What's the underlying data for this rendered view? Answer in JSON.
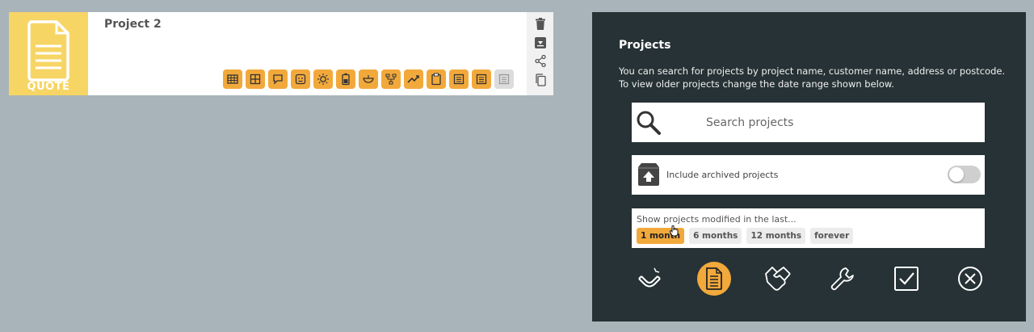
{
  "project_card": {
    "title": "Project 2",
    "type_label": "QUOTE",
    "tools": [
      {
        "icon": "building-grid-icon",
        "enabled": true
      },
      {
        "icon": "window-grid-icon",
        "enabled": true
      },
      {
        "icon": "speech-bubble-icon",
        "enabled": true
      },
      {
        "icon": "face-icon",
        "enabled": true
      },
      {
        "icon": "sun-icon",
        "enabled": true
      },
      {
        "icon": "battery-icon",
        "enabled": true
      },
      {
        "icon": "bowl-icon",
        "enabled": true
      },
      {
        "icon": "hierarchy-icon",
        "enabled": true
      },
      {
        "icon": "trend-icon",
        "enabled": true
      },
      {
        "icon": "clipboard-icon",
        "enabled": true
      },
      {
        "icon": "document-icon",
        "enabled": true
      },
      {
        "icon": "document-icon",
        "enabled": true
      },
      {
        "icon": "document-icon",
        "enabled": false
      }
    ],
    "actions": [
      "trash-icon",
      "archive-icon",
      "share-icon",
      "copy-icon"
    ]
  },
  "panel": {
    "title": "Projects",
    "description": "You can search for projects by project name, customer name, address or postcode. To view older projects change the date range shown below.",
    "search": {
      "placeholder": "Search projects",
      "value": ""
    },
    "archived": {
      "label": "Include archived projects",
      "enabled": false
    },
    "range": {
      "label": "Show projects modified in the last...",
      "options": [
        "1 month",
        "6 months",
        "12 months",
        "forever"
      ],
      "selected": "1 month"
    },
    "nav": [
      "magnet-icon",
      "quote-document-icon",
      "handshake-icon",
      "wrench-icon",
      "checkbox-icon",
      "close-circle-icon"
    ],
    "active_nav": "quote-document-icon"
  },
  "colors": {
    "accent": "#f2a93b",
    "thumb": "#f7d565",
    "panel_bg": "#263235",
    "page_bg": "#a9b4ba"
  }
}
